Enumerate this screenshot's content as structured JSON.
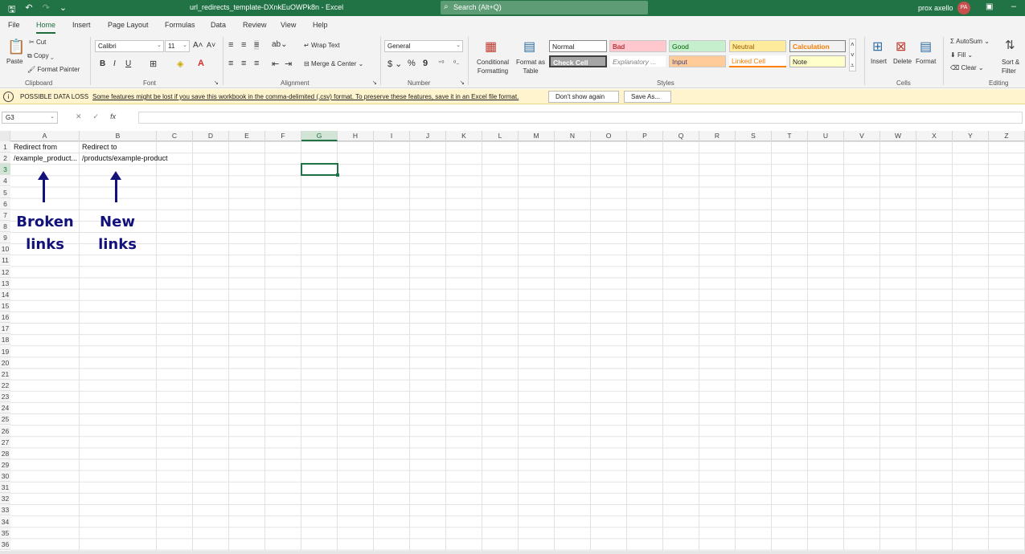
{
  "titlebar": {
    "doc_title": "url_redirects_template-DXnkEuOWPk8n  -  Excel",
    "search_placeholder": "Search (Alt+Q)",
    "user_name": "prox axello",
    "avatar_initials": "PA",
    "accent_color": "#217346"
  },
  "menu": {
    "tabs": [
      "File",
      "Home",
      "Insert",
      "Page Layout",
      "Formulas",
      "Data",
      "Review",
      "View",
      "Help"
    ],
    "active": "Home"
  },
  "ribbon": {
    "clipboard": {
      "paste": "Paste",
      "cut": "Cut",
      "copy": "Copy",
      "format_painter": "Format Painter",
      "label": "Clipboard"
    },
    "font": {
      "name": "Calibri",
      "size": "11",
      "bold": "B",
      "italic": "I",
      "underline": "U",
      "label": "Font"
    },
    "alignment": {
      "wrap_text": "Wrap Text",
      "merge_center": "Merge & Center",
      "label": "Alignment"
    },
    "number": {
      "format": "General",
      "currency": "$",
      "percent": "%",
      "comma": "9",
      "label": "Number"
    },
    "styles": {
      "conditional_formatting": "Conditional Formatting",
      "format_as_table": "Format as Table",
      "cells": [
        "Normal",
        "Bad",
        "Good",
        "Neutral",
        "Calculation",
        "Check Cell",
        "Explanatory ...",
        "Input",
        "Linked Cell",
        "Note"
      ],
      "label": "Styles"
    },
    "cells_group": {
      "insert": "Insert",
      "delete": "Delete",
      "format": "Format",
      "label": "Cells"
    },
    "editing": {
      "autosum": "AutoSum",
      "fill": "Fill",
      "clear": "Clear",
      "sort_filter": "Sort & Filter",
      "label": "Editing"
    }
  },
  "warning": {
    "title": "POSSIBLE DATA LOSS",
    "message": "Some features might be lost if you save this workbook in the comma-delimited (.csv) format. To preserve these features, save it in an Excel file format.",
    "dont_show": "Don't show again",
    "save_as": "Save As..."
  },
  "formula_bar": {
    "name_box": "G3",
    "fx": "fx",
    "value": ""
  },
  "sheet": {
    "columns": [
      "A",
      "B",
      "C",
      "D",
      "E",
      "F",
      "G",
      "H",
      "I",
      "J",
      "K",
      "L",
      "M",
      "N",
      "O",
      "P",
      "Q",
      "R",
      "S",
      "T",
      "U",
      "V",
      "W",
      "X",
      "Y",
      "Z"
    ],
    "selected_column": "G",
    "rows": [
      "1",
      "2",
      "3",
      "4",
      "5",
      "6",
      "7",
      "8",
      "9",
      "10",
      "11",
      "12",
      "13",
      "14",
      "15",
      "16",
      "17",
      "18",
      "19",
      "20",
      "21",
      "22",
      "23",
      "24",
      "25",
      "26",
      "27",
      "28",
      "29",
      "30",
      "31",
      "32",
      "33",
      "34",
      "35",
      "36"
    ],
    "selected_row": "3",
    "cells": {
      "A1": "Redirect from",
      "B1": "Redirect to",
      "A2": "/example_product...",
      "B2": "/products/example-product"
    }
  },
  "annotations": {
    "broken_links": [
      "Broken",
      "links"
    ],
    "new_links": [
      "New",
      "links"
    ]
  }
}
